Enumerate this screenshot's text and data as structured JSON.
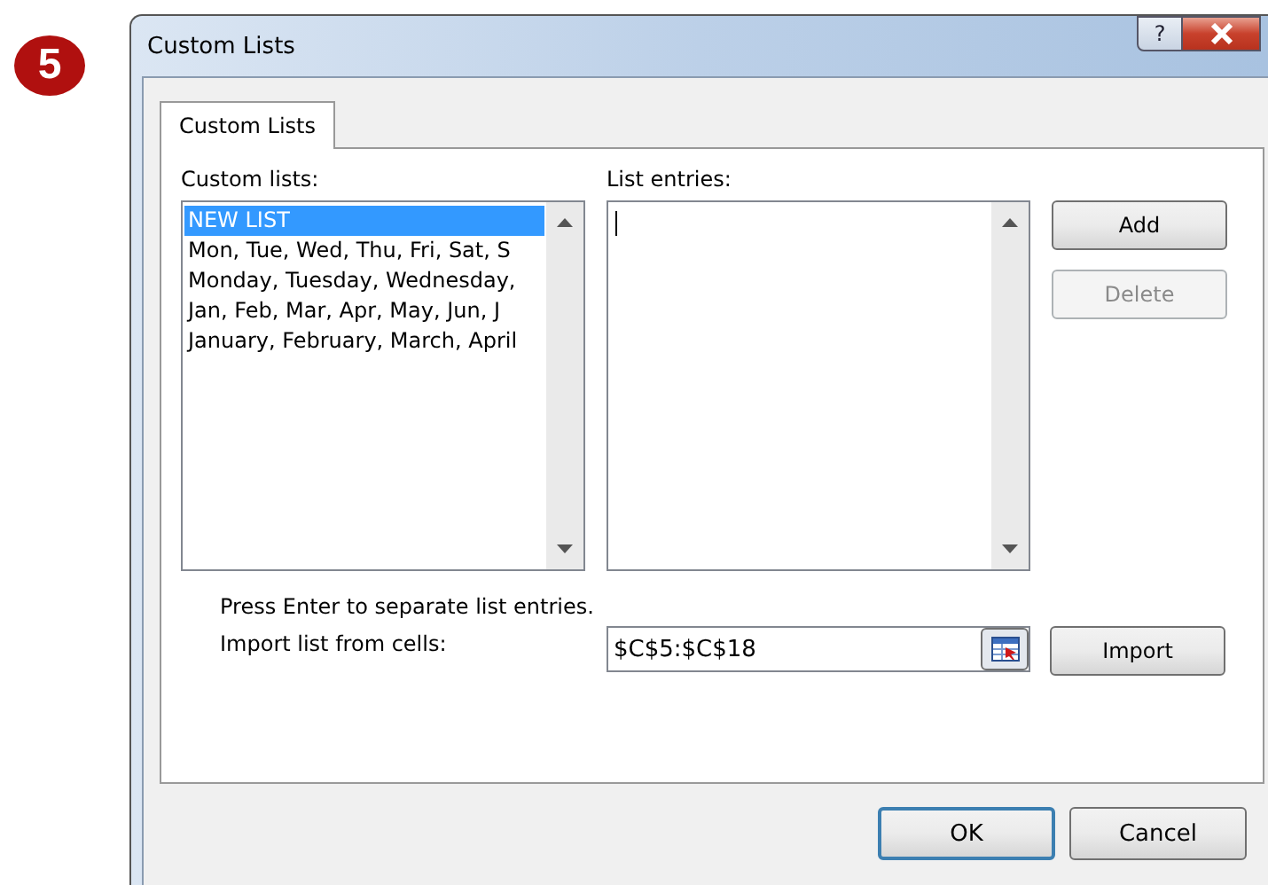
{
  "badge": "5",
  "window": {
    "title": "Custom Lists",
    "help": "?"
  },
  "tabs": [
    {
      "label": "Custom Lists",
      "selected": true
    }
  ],
  "custom_lists": {
    "label": "Custom lists:",
    "items": [
      {
        "text": "NEW LIST",
        "selected": true
      },
      {
        "text": "Mon, Tue, Wed, Thu, Fri, Sat, S",
        "selected": false
      },
      {
        "text": "Monday, Tuesday, Wednesday,",
        "selected": false
      },
      {
        "text": "Jan, Feb, Mar, Apr, May, Jun, J",
        "selected": false
      },
      {
        "text": "January, February, March, April",
        "selected": false
      }
    ]
  },
  "list_entries": {
    "label": "List entries:"
  },
  "side_buttons": [
    {
      "label": "Add",
      "disabled": false
    },
    {
      "label": "Delete",
      "disabled": true
    }
  ],
  "hint": "Press Enter to separate list entries.",
  "import": {
    "label": "Import list from cells:",
    "value": "$C$5:$C$18",
    "button": "Import"
  },
  "footer_buttons": [
    {
      "label": "OK",
      "default": true
    },
    {
      "label": "Cancel",
      "default": false
    }
  ]
}
